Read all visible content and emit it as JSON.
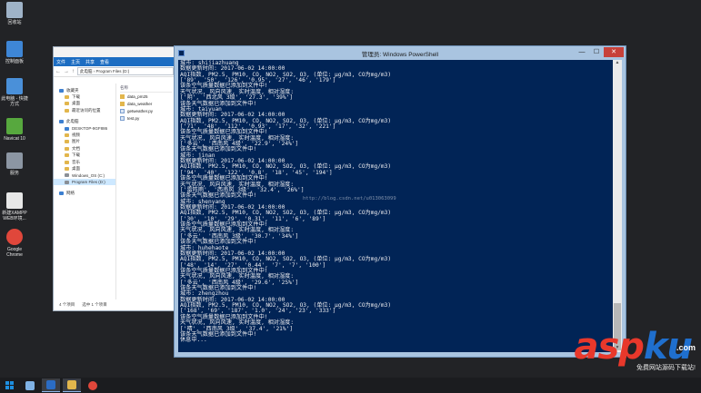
{
  "desktop": {
    "icons": [
      {
        "label": "回收站",
        "icon": "recycle-bin-icon",
        "color": "#9fb3c8"
      },
      {
        "label": "控制面板",
        "icon": "control-panel-icon",
        "color": "#3e86d6"
      },
      {
        "label": "此电脑 - 快捷方式",
        "icon": "computer-icon",
        "color": "#4a90d9"
      },
      {
        "label": "Navicat 10",
        "icon": "navicat-icon",
        "color": "#57a83e"
      },
      {
        "label": "服务",
        "icon": "gear-icon",
        "color": "#8c96a3"
      },
      {
        "label": "新建XAMPP WEB环境...",
        "icon": "text-file-icon",
        "color": "#e7e7e7"
      },
      {
        "label": "Google Chrome",
        "icon": "chrome-icon",
        "color": "#e0473b"
      }
    ]
  },
  "explorer": {
    "tabs": [
      "文件",
      "主页",
      "共享",
      "查看"
    ],
    "address": "此电脑 › Program Files (D:)",
    "column_header": "名称",
    "nav": [
      {
        "label": "收藏夹",
        "level": 1,
        "icon": "star-icon"
      },
      {
        "label": "下载",
        "level": 2,
        "icon": "folder-icon"
      },
      {
        "label": "桌面",
        "level": 2,
        "icon": "folder-icon"
      },
      {
        "label": "最近访问的位置",
        "level": 2,
        "icon": "folder-icon"
      },
      {
        "label": "此电脑",
        "level": 1,
        "icon": "computer-icon",
        "gap": true
      },
      {
        "label": "DESKTOP-9GF886",
        "level": 2,
        "icon": "computer-icon"
      },
      {
        "label": "视频",
        "level": 2,
        "icon": "folder-icon"
      },
      {
        "label": "图片",
        "level": 2,
        "icon": "folder-icon"
      },
      {
        "label": "文档",
        "level": 2,
        "icon": "folder-icon"
      },
      {
        "label": "下载",
        "level": 2,
        "icon": "folder-icon"
      },
      {
        "label": "音乐",
        "level": 2,
        "icon": "folder-icon"
      },
      {
        "label": "桌面",
        "level": 2,
        "icon": "folder-icon"
      },
      {
        "label": "Windows_OS (C:)",
        "level": 2,
        "icon": "drive-icon"
      },
      {
        "label": "Program Files (D:)",
        "level": 2,
        "icon": "drive-icon",
        "selected": true
      },
      {
        "label": "网络",
        "level": 1,
        "icon": "network-icon",
        "gap": true
      }
    ],
    "files": [
      {
        "name": "data_pm25",
        "type": "folder"
      },
      {
        "name": "data_weather",
        "type": "folder"
      },
      {
        "name": "getweather.py",
        "type": "py"
      },
      {
        "name": "test.py",
        "type": "py"
      }
    ],
    "status": {
      "count": "4 个项目",
      "selected": "选中 1 个项目"
    }
  },
  "powershell": {
    "title": "管理员: Windows PowerShell",
    "watermark": "http://blog.csdn.net/u013063099",
    "lines": [
      "城市: shijiazhuang",
      "数据更新时间: 2017-06-02 14:00:00",
      "AQI指数, PM2.5, PM10, CO, NO2, SO2, O3, (单位: μg/m3, CO为mg/m3)",
      "['89', '50', '126', '0.95', '27', '46', '179']",
      "该条空气质量数据已添加到文件中!",
      "天气状况, 风向风速, 实时温度, 相对湿度:",
      "['阴', '西北风 3级', '27.3', '39%']",
      "该条天气数据已添加到文件中!",
      "城市: taiyuan",
      "数据更新时间: 2017-06-02 14:00:00",
      "AQI指数, PM2.5, PM10, CO, NO2, SO2, O3, (单位: μg/m3, CO为mg/m3)",
      "['71', '48', '112', '0.93', '17', '32', '221']",
      "该条空气质量数据已添加到文件中!",
      "天气状况, 风向风速, 实时温度, 相对湿度:",
      "['多云', '西南风 4级', '22.9', '24%']",
      "该条天气数据已添加到文件中!",
      "城市: jinan",
      "数据更新时间: 2017-06-02 14:00:00",
      "AQI指数, PM2.5, PM10, CO, NO2, SO2, O3, (单位: μg/m3, CO为mg/m3)",
      "['94', '40', '122', '0.8', '18', '45', '194']",
      "该条空气质量数据已添加到文件中!",
      "天气状况, 风向风速, 实时温度, 相对湿度:",
      "['雷阵雨', '西南风 3级', '32.4', '26%']",
      "该条天气数据已添加到文件中!",
      "城市: shenyang",
      "数据更新时间: 2017-06-02 14:00:00",
      "AQI指数, PM2.5, PM10, CO, NO2, SO2, O3, (单位: μg/m3, CO为mg/m3)",
      "['30', '10', '29', '0.31', '11', '6', '89']",
      "该条空气质量数据已添加到文件中!",
      "天气状况, 风向风速, 实时温度, 相对湿度:",
      "['多云', '西南风 3级', '30.7', '34%']",
      "该条天气数据已添加到文件中!",
      "城市: huhehaote",
      "数据更新时间: 2017-06-02 14:00:00",
      "AQI指数, PM2.5, PM10, CO, NO2, SO2, O3, (单位: μg/m3, CO为mg/m3)",
      "['48', '14', '27', '0.44', '7', '7', '100']",
      "该条空气质量数据已添加到文件中!",
      "天气状况, 风向风速, 实时温度, 相对湿度:",
      "['多云', '西南风 4级', '29.6', '25%']",
      "该条天气数据已添加到文件中!",
      "城市: zhengzhou",
      "数据更新时间: 2017-06-02 14:00:00",
      "AQI指数, PM2.5, PM10, CO, NO2, SO2, O3, (单位: μg/m3, CO为mg/m3)",
      "['168', '69', '187', '1.0', '24', '23', '333']",
      "该条空气质量数据已添加到文件中!",
      "天气状况, 风向风速, 实时温度, 相对湿度:",
      "['晴', '西南风 3级', '37.4', '21%']",
      "该条天气数据已添加到文件中!",
      "休息中..."
    ]
  },
  "taskbar": {
    "items": [
      {
        "name": "start-button",
        "icon": "windows-logo-icon"
      },
      {
        "name": "server-manager-button",
        "icon": "server-manager-icon",
        "color": "#7fb2e5"
      },
      {
        "name": "powershell-taskbar-button",
        "icon": "powershell-icon",
        "color": "#2b6cc4",
        "active": true
      },
      {
        "name": "explorer-taskbar-button",
        "icon": "folder-icon",
        "color": "#e2b64c",
        "active": true
      },
      {
        "name": "chrome-taskbar-button",
        "icon": "chrome-icon",
        "color": "#e0473b"
      }
    ]
  },
  "brand": {
    "part1": "asp",
    "part2": "ku",
    "dotcom": ".com",
    "tagline": "免费网站源码下载站!"
  }
}
